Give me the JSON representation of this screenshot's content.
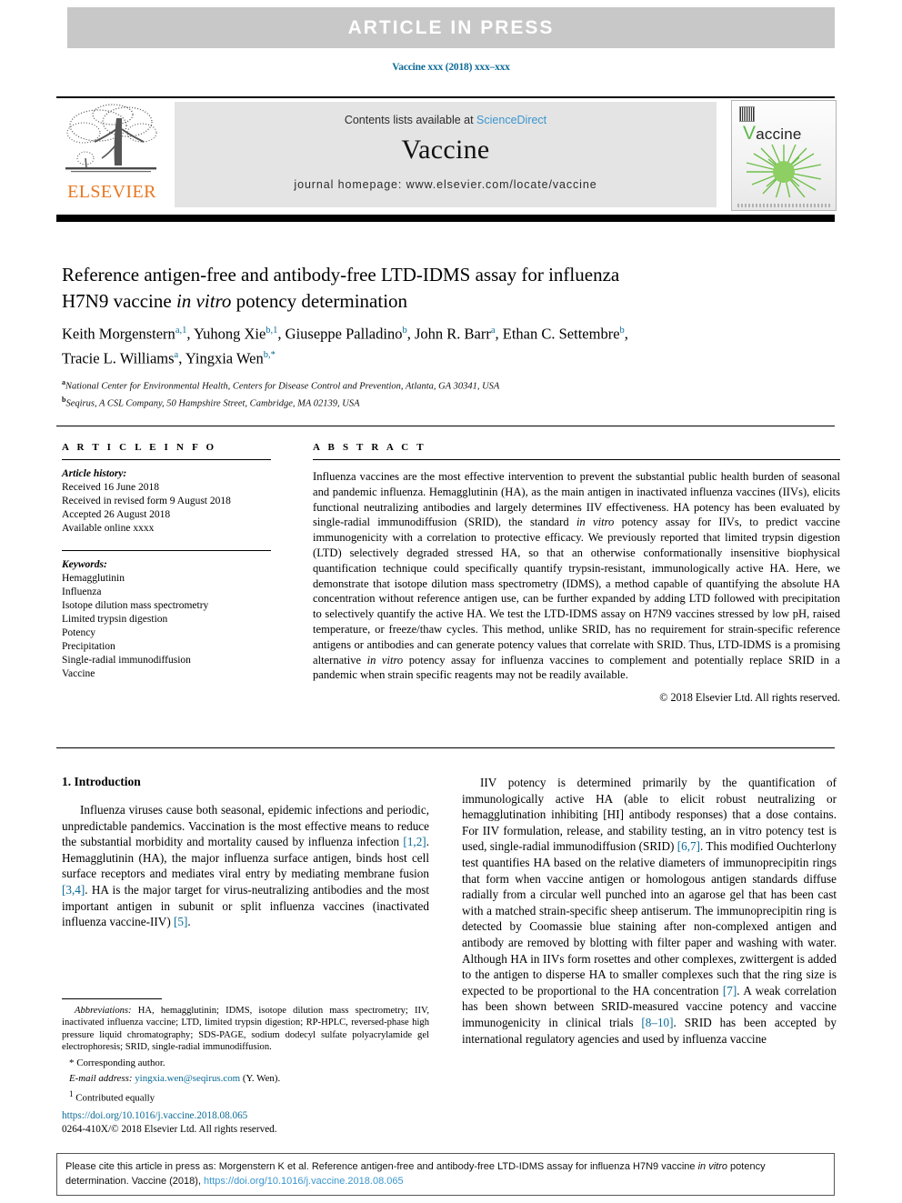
{
  "banner": {
    "text": "ARTICLE  IN  PRESS"
  },
  "running_head": {
    "text": "Vaccine xxx (2018) xxx–xxx"
  },
  "masthead": {
    "contents_prefix": "Contents lists available at ",
    "sciencedirect": "ScienceDirect",
    "journal_name": "Vaccine",
    "homepage": "journal homepage: www.elsevier.com/locate/vaccine",
    "publisher_wordmark": "ELSEVIER",
    "cover_v": "V",
    "cover_rest": "accine"
  },
  "article": {
    "title_line1": "Reference antigen-free and antibody-free LTD-IDMS assay for influenza",
    "title_line2_a": "H7N9 vaccine ",
    "title_line2_italic": "in vitro",
    "title_line2_b": " potency determination",
    "authors": [
      {
        "name": "Keith Morgenstern",
        "marks": "a,1",
        "sep": ", "
      },
      {
        "name": "Yuhong Xie",
        "marks": "b,1",
        "sep": ", "
      },
      {
        "name": "Giuseppe Palladino",
        "marks": "b",
        "sep": ", "
      },
      {
        "name": "John R. Barr",
        "marks": "a",
        "sep": ", "
      },
      {
        "name": "Ethan C. Settembre",
        "marks": "b",
        "sep": ", "
      },
      {
        "name": "Tracie L. Williams",
        "marks": "a",
        "sep": ", "
      },
      {
        "name": "Yingxia Wen",
        "marks": "b,*",
        "sep": ""
      }
    ],
    "affiliations": [
      {
        "mark": "a",
        "text": "National Center for Environmental Health, Centers for Disease Control and Prevention, Atlanta, GA 30341, USA"
      },
      {
        "mark": "b",
        "text": "Seqirus, A CSL Company, 50 Hampshire Street, Cambridge, MA 02139, USA"
      }
    ]
  },
  "article_info": {
    "heading": "A R T I C L E   I N F O",
    "history_label": "Article history:",
    "history": [
      "Received 16 June 2018",
      "Received in revised form 9 August 2018",
      "Accepted 26 August 2018",
      "Available online xxxx"
    ],
    "keywords_label": "Keywords:",
    "keywords": [
      "Hemagglutinin",
      "Influenza",
      "Isotope dilution mass spectrometry",
      "Limited trypsin digestion",
      "Potency",
      "Precipitation",
      "Single-radial immunodiffusion",
      "Vaccine"
    ]
  },
  "abstract": {
    "heading": "A B S T R A C T",
    "p1": "Influenza vaccines are the most effective intervention to prevent the substantial public health burden of seasonal and pandemic influenza. Hemagglutinin (HA), as the main antigen in inactivated influenza vaccines (IIVs), elicits functional neutralizing antibodies and largely determines IIV effectiveness. HA potency has been evaluated by single-radial immunodiffusion (SRID), the standard ",
    "p1_ital": "in vitro",
    "p1_b": " potency assay for IIVs, to predict vaccine immunogenicity with a correlation to protective efficacy. We previously reported that limited trypsin digestion (LTD) selectively degraded stressed HA, so that an otherwise conformationally insensitive biophysical quantification technique could specifically quantify trypsin-resistant, immunologically active HA. Here, we demonstrate that isotope dilution mass spectrometry (IDMS), a method capable of quantifying the absolute HA concentration without reference antigen use, can be further expanded by adding LTD followed with precipitation to selectively quantify the active HA. We test the LTD-IDMS assay on H7N9 vaccines stressed by low pH, raised temperature, or freeze/thaw cycles. This method, unlike SRID, has no requirement for strain-specific reference antigens or antibodies and can generate potency values that correlate with SRID. Thus, LTD-IDMS is a promising alternative ",
    "p1_ital2": "in vitro",
    "p1_c": " potency assay for influenza vaccines to complement and potentially replace SRID in a pandemic when strain specific reagents may not be readily available.",
    "copyright": "© 2018 Elsevier Ltd. All rights reserved."
  },
  "body": {
    "section_heading": "1. Introduction",
    "left_p1_a": "Influenza viruses cause both seasonal, epidemic infections and periodic, unpredictable pandemics. Vaccination is the most effective means to reduce the substantial morbidity and mortality caused by influenza infection ",
    "left_ref1": "[1,2]",
    "left_p1_b": ". Hemagglutinin (HA), the major influenza surface antigen, binds host cell surface receptors and mediates viral entry by mediating membrane fusion ",
    "left_ref2": "[3,4]",
    "left_p1_c": ". HA is the major target for virus-neutralizing antibodies and the most important antigen in subunit or split influenza vaccines (inactivated influenza vaccine-IIV) ",
    "left_ref3": "[5]",
    "left_p1_d": ".",
    "right_p1_a": "IIV potency is determined primarily by the quantification of immunologically active HA (able to elicit robust neutralizing or hemagglutination inhibiting [HI] antibody responses) that a dose contains. For IIV formulation, release, and stability testing, an in vitro potency test is used, single-radial immunodiffusion (SRID) ",
    "right_ref1": "[6,7]",
    "right_p1_b": ". This modified Ouchterlony test quantifies HA based on the relative diameters of immunoprecipitin rings that form when vaccine antigen or homologous antigen standards diffuse radially from a circular well punched into an agarose gel that has been cast with a matched strain-specific sheep antiserum. The immunoprecipitin ring is detected by Coomassie blue staining after non-complexed antigen and antibody are removed by blotting with filter paper and washing with water. Although HA in IIVs form rosettes and other complexes, zwittergent is added to the antigen to disperse HA to smaller complexes such that the ring size is expected to be proportional to the HA concentration ",
    "right_ref2": "[7]",
    "right_p1_c": ". A weak correlation has been shown between SRID-measured vaccine potency and vaccine immunogenicity in clinical trials ",
    "right_ref3": "[8–10]",
    "right_p1_d": ". SRID has been accepted by international regulatory agencies and used by influenza vaccine"
  },
  "footnotes": {
    "abbrev_label": "Abbreviations:",
    "abbrev_text": " HA, hemagglutinin; IDMS, isotope dilution mass spectrometry; IIV, inactivated influenza vaccine; LTD, limited trypsin digestion; RP-HPLC, reversed-phase high pressure liquid chromatography; SDS-PAGE, sodium dodecyl sulfate polyacrylamide gel electrophoresis; SRID, single-radial immunodiffusion.",
    "corresponding_mark": "*",
    "corresponding_text": "Corresponding author.",
    "email_label": "E-mail address:",
    "email": "yingxia.wen@seqirus.com",
    "email_suffix": " (Y. Wen).",
    "contributed_mark": "1",
    "contributed_text": "Contributed equally",
    "doi": "https://doi.org/10.1016/j.vaccine.2018.08.065",
    "issn_line": "0264-410X/© 2018 Elsevier Ltd. All rights reserved."
  },
  "cite_footer": {
    "prefix": "Please cite this article in press as: Morgenstern K et al. Reference antigen-free and antibody-free LTD-IDMS assay for influenza H7N9 vaccine ",
    "italic": "in vitro",
    "middle": " potency determination. Vaccine (2018), ",
    "link": "https://doi.org/10.1016/j.vaccine.2018.08.065"
  },
  "colors": {
    "link_blue": "#0b6a96",
    "sciencedirect_blue": "#3a96cf",
    "elsevier_orange": "#e87722",
    "banner_gray": "#c8c8c8",
    "masthead_gray": "#e4e4e4",
    "cover_green": "#59b947"
  }
}
